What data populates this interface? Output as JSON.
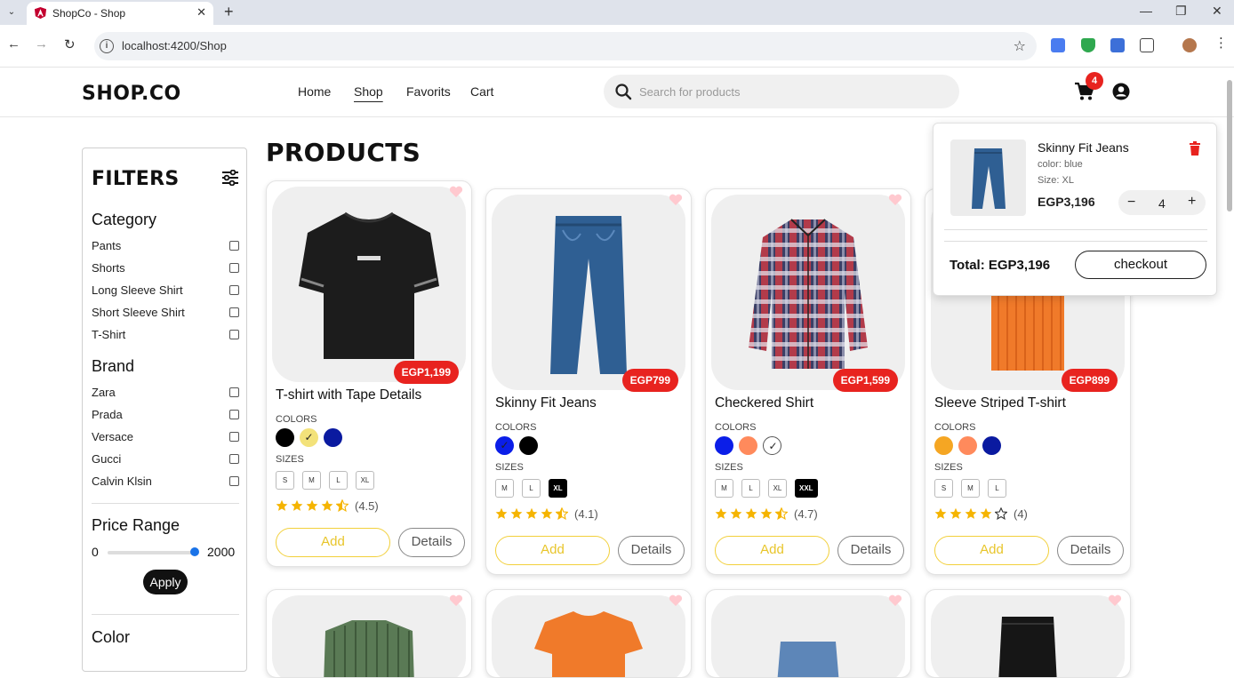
{
  "browser": {
    "tab_title": "ShopCo - Shop",
    "url": "localhost:4200/Shop"
  },
  "header": {
    "logo": "SHOP.CO",
    "nav": [
      "Home",
      "Shop",
      "Favorits",
      "Cart"
    ],
    "active_nav": "Shop",
    "search_placeholder": "Search for products",
    "cart_count": "4"
  },
  "filters": {
    "title": "FILTERS",
    "category_title": "Category",
    "categories": [
      "Pants",
      "Shorts",
      "Long Sleeve Shirt",
      "Short Sleeve Shirt",
      "T-Shirt"
    ],
    "brand_title": "Brand",
    "brands": [
      "Zara",
      "Prada",
      "Versace",
      "Gucci",
      "Calvin Klsin"
    ],
    "price_title": "Price Range",
    "price_min": "0",
    "price_max": "2000",
    "price_level": 1.0,
    "apply": "Apply",
    "color_title": "Color"
  },
  "products_title": "PRODUCTS",
  "labels": {
    "colors": "COLORS",
    "sizes": "SIZES",
    "add": "Add",
    "details": "Details"
  },
  "products": [
    {
      "name": "T-shirt with Tape Details",
      "price": "EGP1,199",
      "colors": [
        "#000000",
        "#f3e27a",
        "#0a1aa0"
      ],
      "selected_color": 1,
      "sizes": [
        "S",
        "M",
        "L",
        "XL"
      ],
      "selected_size": -1,
      "stars": 4.5,
      "rating": "(4.5)",
      "image": "tshirt-black"
    },
    {
      "name": "Skinny Fit Jeans",
      "price": "EGP799",
      "colors": [
        "#0b1ee8",
        "#000000"
      ],
      "selected_color": 0,
      "sizes": [
        "M",
        "L",
        "XL"
      ],
      "selected_size": 2,
      "stars": 4.5,
      "rating": "(4.1)",
      "image": "jeans-blue"
    },
    {
      "name": "Checkered Shirt",
      "price": "EGP1,599",
      "colors": [
        "#0b1ee8",
        "#ff8a5c",
        "#ffffff"
      ],
      "selected_color": 2,
      "sizes": [
        "M",
        "L",
        "XL",
        "XXL"
      ],
      "selected_size": 3,
      "stars": 4.5,
      "rating": "(4.7)",
      "image": "shirt-checkered"
    },
    {
      "name": "Sleeve Striped T-shirt",
      "price": "EGP899",
      "colors": [
        "#f5a623",
        "#ff8a5c",
        "#0a1aa0"
      ],
      "selected_color": -1,
      "sizes": [
        "S",
        "M",
        "L"
      ],
      "selected_size": -1,
      "stars": 4,
      "rating": "(4)",
      "image": "tshirt-orange"
    }
  ],
  "cart": {
    "item_name": "Skinny Fit Jeans",
    "item_color": "color: blue",
    "item_size": "Size: XL",
    "item_price": "EGP3,196",
    "quantity": "4",
    "minus": "−",
    "plus": "+",
    "total": "Total: EGP3,196",
    "checkout": "checkout"
  },
  "colors": {
    "price_badge": "#e8231f",
    "add_border": "#f2d03b",
    "star": "#f5b400",
    "cart_badge": "#e8231f"
  }
}
